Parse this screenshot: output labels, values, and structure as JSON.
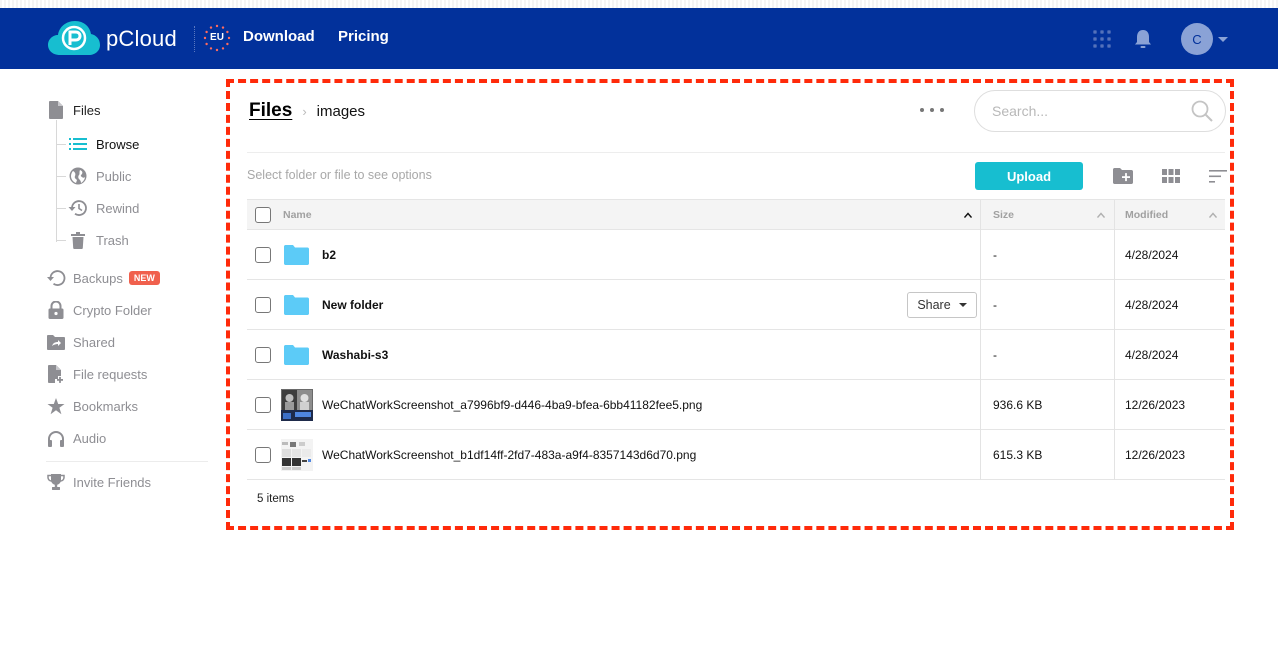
{
  "header": {
    "brand": "pCloud",
    "region": "EU",
    "nav": [
      {
        "label": "Download"
      },
      {
        "label": "Pricing"
      }
    ],
    "avatar_initial": "C",
    "brand_color": "#02319b",
    "accent_color": "#17bed0"
  },
  "sidebar": {
    "files_label": "Files",
    "sub_items": [
      {
        "label": "Browse",
        "icon": "list-icon",
        "active": true
      },
      {
        "label": "Public",
        "icon": "globe-icon"
      },
      {
        "label": "Rewind",
        "icon": "history-icon"
      },
      {
        "label": "Trash",
        "icon": "trash-icon"
      }
    ],
    "items": [
      {
        "label": "Backups",
        "icon": "backup-icon",
        "badge": "NEW"
      },
      {
        "label": "Crypto Folder",
        "icon": "lock-icon"
      },
      {
        "label": "Shared",
        "icon": "shared-folder-icon"
      },
      {
        "label": "File requests",
        "icon": "file-request-icon"
      },
      {
        "label": "Bookmarks",
        "icon": "star-icon"
      },
      {
        "label": "Audio",
        "icon": "headphones-icon"
      }
    ],
    "invite_label": "Invite Friends"
  },
  "main": {
    "breadcrumb": {
      "root": "Files",
      "current": "images"
    },
    "search_placeholder": "Search...",
    "hint": "Select folder or file to see options",
    "upload_label": "Upload",
    "columns": {
      "name": "Name",
      "size": "Size",
      "modified": "Modified"
    },
    "rows": [
      {
        "name": "b2",
        "type": "folder",
        "size": "-",
        "modified": "4/28/2024"
      },
      {
        "name": "New folder",
        "type": "folder",
        "size": "-",
        "modified": "4/28/2024",
        "share_label": "Share"
      },
      {
        "name": "Washabi-s3",
        "type": "folder",
        "size": "-",
        "modified": "4/28/2024"
      },
      {
        "name": "WeChatWorkScreenshot_a7996bf9-d446-4ba9-bfea-6bb41182fee5.png",
        "type": "image",
        "size": "936.6 KB",
        "modified": "12/26/2023"
      },
      {
        "name": "WeChatWorkScreenshot_b1df14ff-2fd7-483a-a9f4-8357143d6d70.png",
        "type": "image",
        "size": "615.3 KB",
        "modified": "12/26/2023"
      }
    ],
    "item_count": "5 items"
  }
}
